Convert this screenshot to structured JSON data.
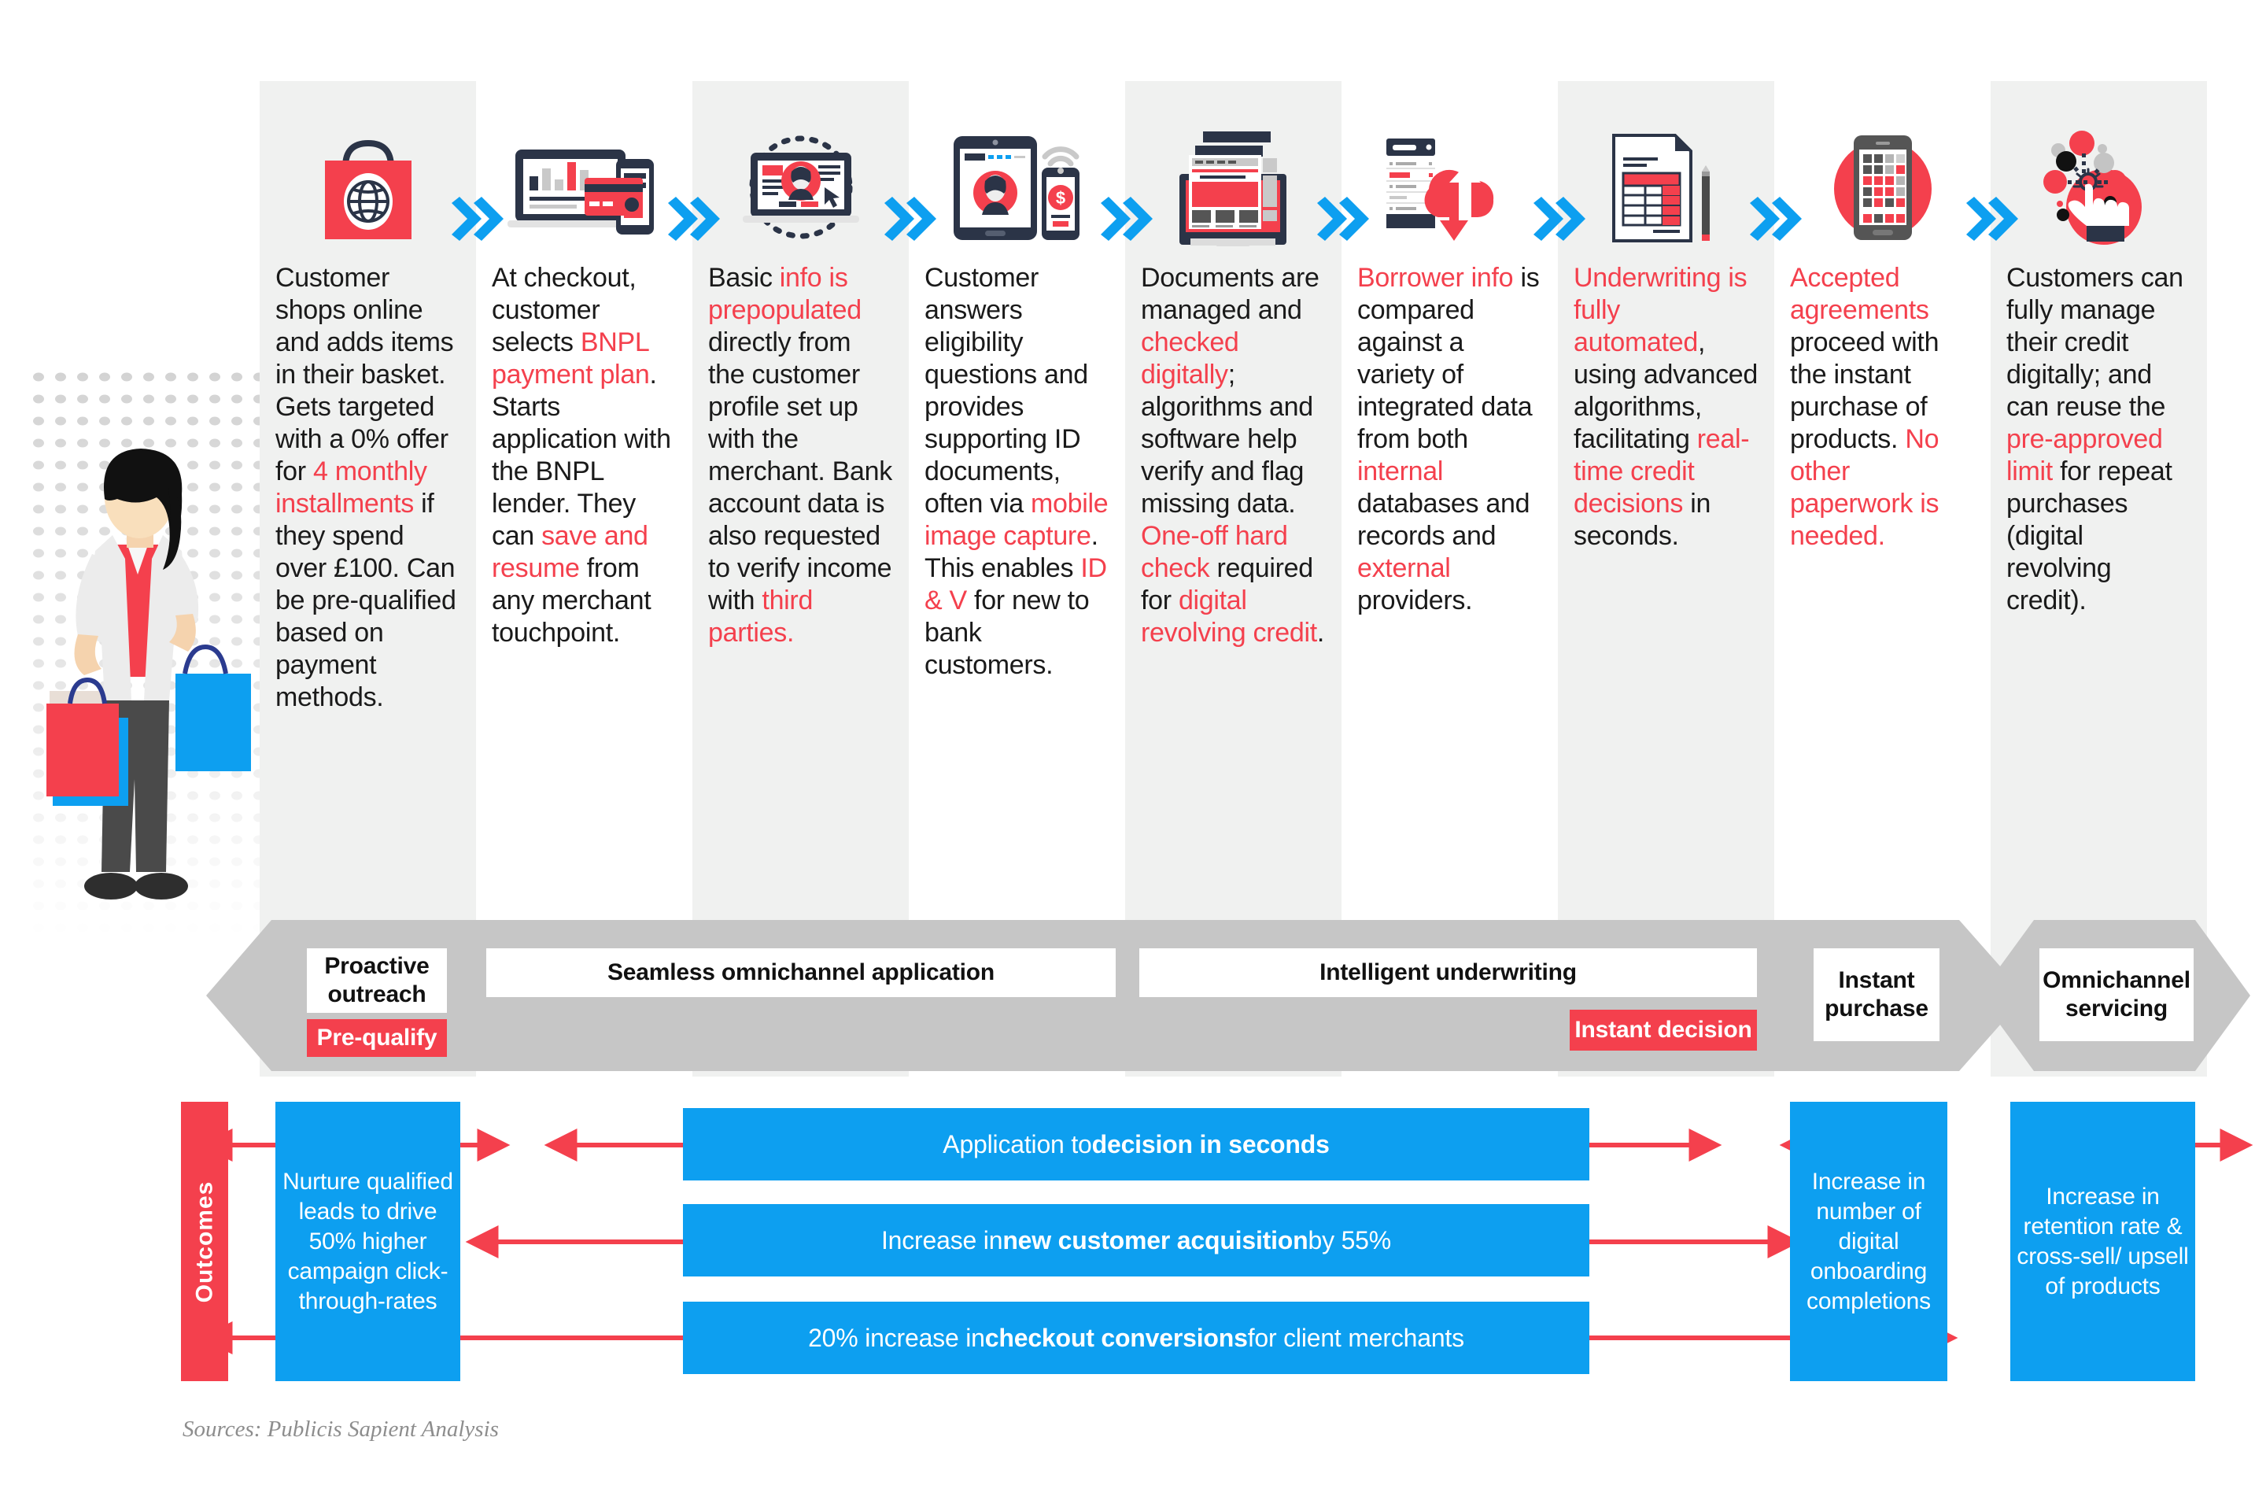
{
  "colors": {
    "accent_red": "#f4404d",
    "accent_blue": "#0d9ff0",
    "chevron_blue": "#0d9ff0",
    "stripe_gray": "#f0f1f0",
    "banner_gray": "#c6c6c6",
    "text_dark": "#1a1a1a",
    "icon_navy": "#2b3447"
  },
  "journey": {
    "steps": [
      {
        "id": "step-1",
        "icon": "shopping-bag-globe-icon",
        "runs": [
          {
            "t": "Customer shops online and adds items in their basket. Gets targeted with a 0% offer for ",
            "hl": false
          },
          {
            "t": "4 monthly installments",
            "hl": true
          },
          {
            "t": " if they spend over £100. Can be pre-qualified based on payment methods.",
            "hl": false
          }
        ]
      },
      {
        "id": "step-2",
        "icon": "laptop-mobile-creditcard-icon",
        "runs": [
          {
            "t": "At checkout, customer selects ",
            "hl": false
          },
          {
            "t": "BNPL payment plan",
            "hl": true
          },
          {
            "t": ". Starts application with the BNPL lender. They can ",
            "hl": false
          },
          {
            "t": "save and resume",
            "hl": true
          },
          {
            "t": " from any merchant touchpoint.",
            "hl": false
          }
        ]
      },
      {
        "id": "step-3",
        "icon": "laptop-customer-profile-icon",
        "runs": [
          {
            "t": "Basic ",
            "hl": false
          },
          {
            "t": "info is prepopulated",
            "hl": true
          },
          {
            "t": " directly from the customer profile set up with the merchant. Bank account data is also requested to verify income with ",
            "hl": false
          },
          {
            "t": "third parties.",
            "hl": true
          }
        ]
      },
      {
        "id": "step-4",
        "icon": "tablet-phone-id-verification-icon",
        "runs": [
          {
            "t": "Customer answers eligibility questions and provides supporting ID documents, often via ",
            "hl": false
          },
          {
            "t": "mobile image capture",
            "hl": true
          },
          {
            "t": ". This enables ",
            "hl": false
          },
          {
            "t": "ID & V",
            "hl": true
          },
          {
            "t": " for new to bank customers.",
            "hl": false
          }
        ]
      },
      {
        "id": "step-5",
        "icon": "desktop-documents-icon",
        "runs": [
          {
            "t": "Documents are managed and ",
            "hl": false
          },
          {
            "t": "checked digitally",
            "hl": true
          },
          {
            "t": "; algorithms and software help verify and flag missing data. ",
            "hl": false
          },
          {
            "t": "One-off hard check",
            "hl": true
          },
          {
            "t": " required for ",
            "hl": false
          },
          {
            "t": "digital revolving credit",
            "hl": true
          },
          {
            "t": ".",
            "hl": false
          }
        ]
      },
      {
        "id": "step-6",
        "icon": "cloud-data-sync-icon",
        "runs": [
          {
            "t": "Borrower info",
            "hl": true
          },
          {
            "t": " is compared against a variety of integrated data from both ",
            "hl": false
          },
          {
            "t": "internal",
            "hl": true
          },
          {
            "t": " databases and records and ",
            "hl": false
          },
          {
            "t": "external",
            "hl": true
          },
          {
            "t": " providers.",
            "hl": false
          }
        ]
      },
      {
        "id": "step-7",
        "icon": "document-table-pen-icon",
        "runs": [
          {
            "t": "Underwriting is fully automated",
            "hl": true
          },
          {
            "t": ", using advanced algorithms, facilitating ",
            "hl": false
          },
          {
            "t": "real-time credit decisions",
            "hl": true
          },
          {
            "t": " in seconds.",
            "hl": false
          }
        ]
      },
      {
        "id": "step-8",
        "icon": "mobile-apps-grid-icon",
        "runs": [
          {
            "t": "Accepted agreements",
            "hl": true
          },
          {
            "t": " proceed with the instant purchase of products. ",
            "hl": false
          },
          {
            "t": "No other paperwork is needed.",
            "hl": true
          }
        ]
      },
      {
        "id": "step-9",
        "icon": "click-hand-network-icon",
        "runs": [
          {
            "t": "Customers can fully manage their credit digitally; and can reuse the ",
            "hl": false
          },
          {
            "t": "pre-approved limit",
            "hl": true
          },
          {
            "t": " for repeat purchases (digital revolving credit).",
            "hl": false
          }
        ]
      }
    ]
  },
  "stage_banner": {
    "labels": [
      {
        "id": "proactive-outreach",
        "text": "Proactive outreach"
      },
      {
        "id": "seamless-omnichannel-application",
        "text": "Seamless omnichannel application"
      },
      {
        "id": "intelligent-underwriting",
        "text": "Intelligent underwriting"
      },
      {
        "id": "instant-purchase",
        "text": "Instant purchase"
      },
      {
        "id": "omnichannel-servicing",
        "text": "Omnichannel servicing"
      }
    ],
    "pills": [
      {
        "id": "pre-qualify",
        "text": "Pre-qualify"
      },
      {
        "id": "instant-decision",
        "text": "Instant decision"
      }
    ]
  },
  "outcomes": {
    "tab_label": "Outcomes",
    "left_box": "Nurture qualified leads to drive 50% higher campaign click-through-rates",
    "bars": [
      {
        "id": "decision-in-seconds",
        "pre": "Application to ",
        "strong": "decision in seconds",
        "post": ""
      },
      {
        "id": "new-customer-acquisition",
        "pre": "Increase in ",
        "strong": "new customer acquisition",
        "post": " by 55%"
      },
      {
        "id": "checkout-conversions",
        "pre": "20% increase in ",
        "strong": "checkout conversions",
        "post": " for client merchants"
      }
    ],
    "right_boxes": [
      {
        "id": "digital-onboarding-completions",
        "text": "Increase in number of digital onboarding completions"
      },
      {
        "id": "retention-cross-sell",
        "text": "Increase in retention rate & cross-sell/ upsell of products"
      }
    ]
  },
  "footer": {
    "source": "Sources: Publicis Sapient Analysis"
  }
}
